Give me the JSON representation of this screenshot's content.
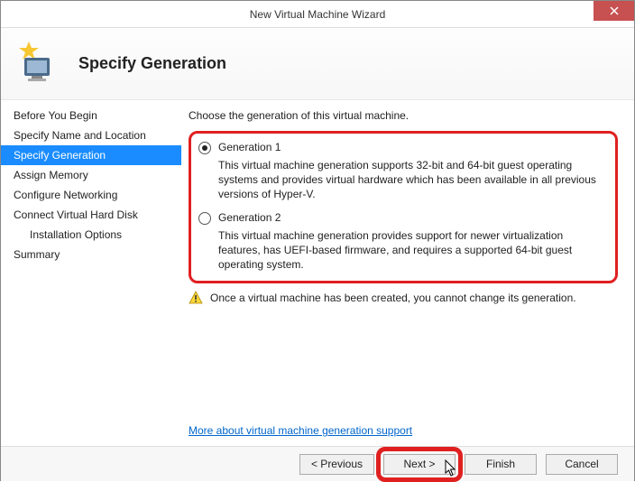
{
  "window": {
    "title": "New Virtual Machine Wizard"
  },
  "header": {
    "title": "Specify Generation"
  },
  "sidebar": {
    "items": [
      {
        "label": "Before You Begin"
      },
      {
        "label": "Specify Name and Location"
      },
      {
        "label": "Specify Generation"
      },
      {
        "label": "Assign Memory"
      },
      {
        "label": "Configure Networking"
      },
      {
        "label": "Connect Virtual Hard Disk"
      },
      {
        "label": "Installation Options"
      },
      {
        "label": "Summary"
      }
    ]
  },
  "main": {
    "prompt": "Choose the generation of this virtual machine.",
    "options": [
      {
        "label": "Generation 1",
        "desc": "This virtual machine generation supports 32-bit and 64-bit guest operating systems and provides virtual hardware which has been available in all previous versions of Hyper-V."
      },
      {
        "label": "Generation 2",
        "desc": "This virtual machine generation provides support for newer virtualization features, has UEFI-based firmware, and requires a supported 64-bit guest operating system."
      }
    ],
    "warning": "Once a virtual machine has been created, you cannot change its generation.",
    "more_link": "More about virtual machine generation support"
  },
  "footer": {
    "previous": "< Previous",
    "next": "Next >",
    "finish": "Finish",
    "cancel": "Cancel"
  }
}
